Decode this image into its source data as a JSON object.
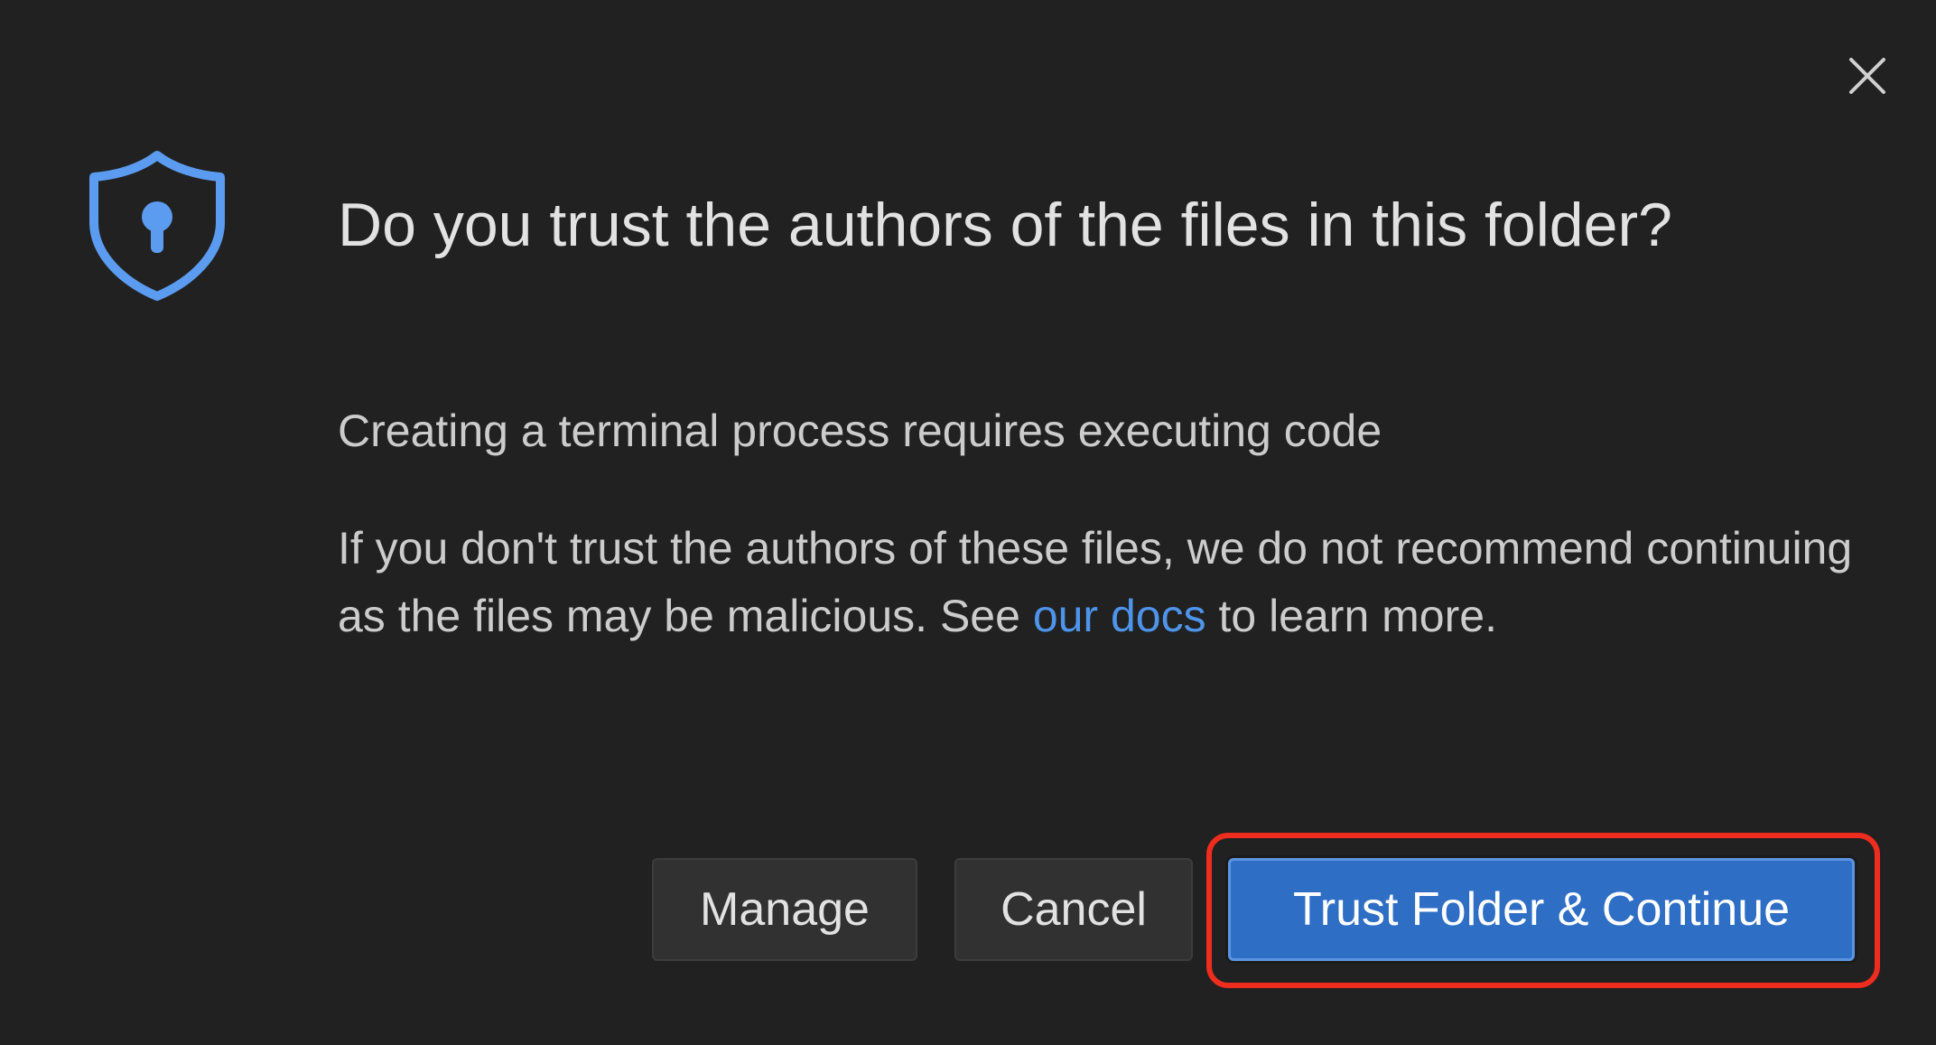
{
  "dialog": {
    "title": "Do you trust the authors of the files in this folder?",
    "detail": "Creating a terminal process requires executing code",
    "message_before_link": "If you don't trust the authors of these files, we do not recommend continuing as the files may be malicious. See ",
    "link_text": "our docs",
    "message_after_link": " to learn more.",
    "icon": "shield-keyhole-icon",
    "close_icon": "close-icon"
  },
  "buttons": {
    "manage_label": "Manage",
    "cancel_label": "Cancel",
    "trust_label": "Trust Folder & Continue"
  },
  "colors": {
    "background": "#212121",
    "accent": "#2f6ec5",
    "link": "#4e94ea",
    "shield": "#5b9bf0",
    "highlight": "#ee2d1e"
  }
}
